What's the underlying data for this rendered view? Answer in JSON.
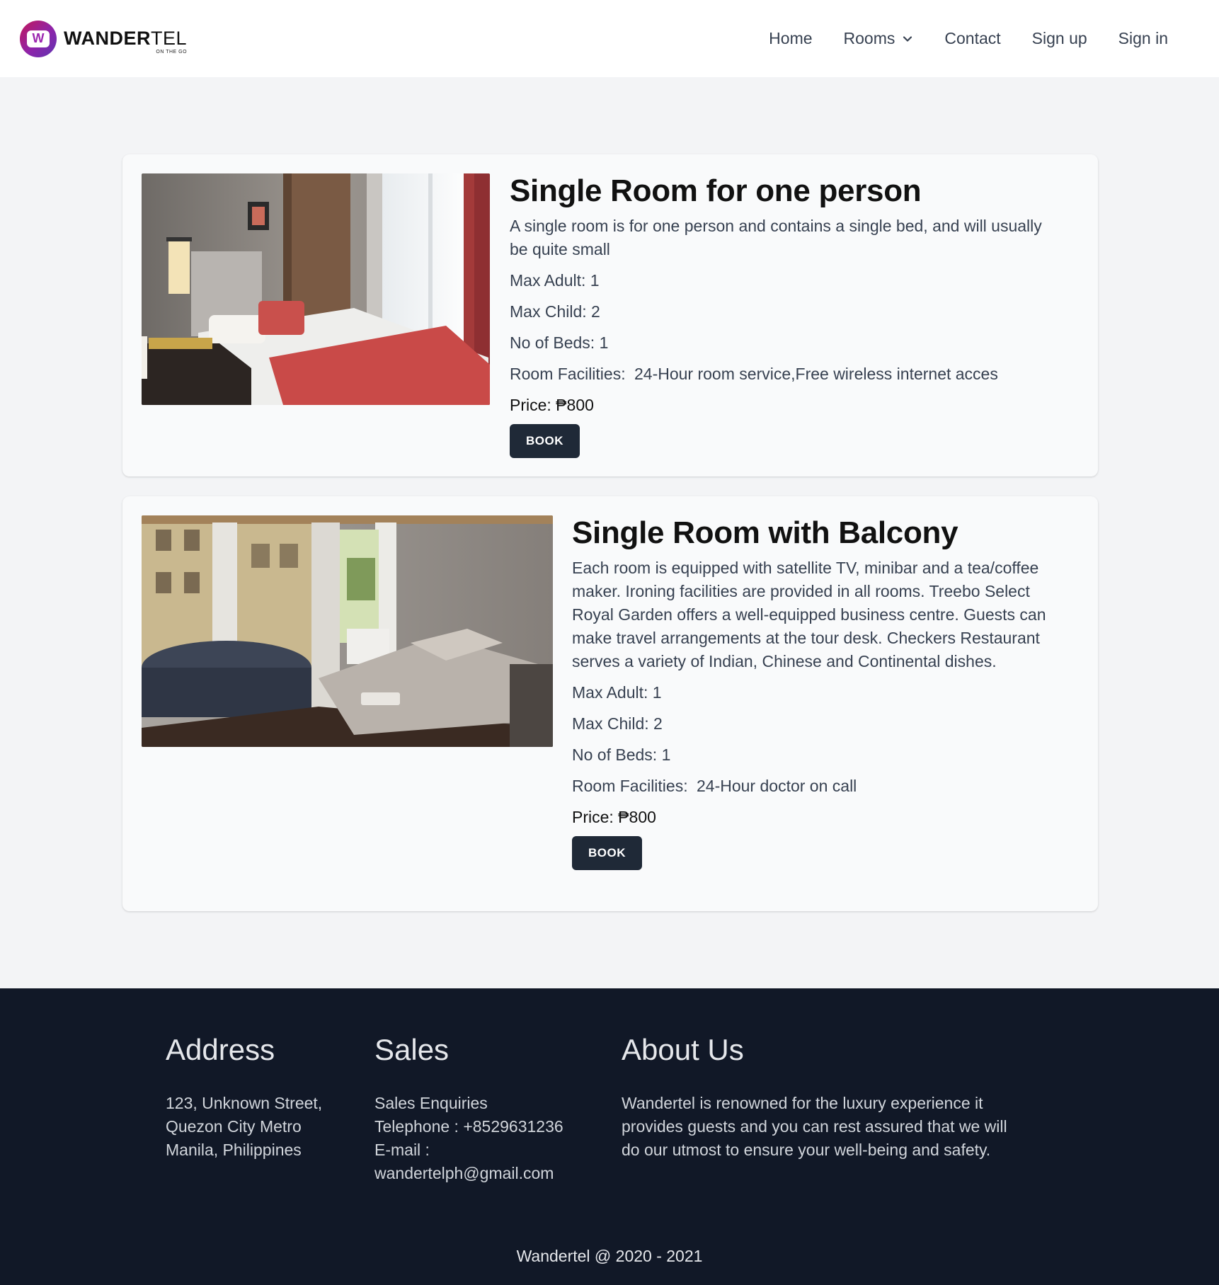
{
  "header": {
    "brand": {
      "name_bold": "WANDER",
      "name_light": "TEL",
      "tagline": "ON THE GO",
      "logo_letter": "W"
    },
    "nav": [
      {
        "label": "Home"
      },
      {
        "label": "Rooms",
        "icon": "chevron-down-icon"
      },
      {
        "label": "Contact"
      },
      {
        "label": "Sign up"
      },
      {
        "label": "Sign in"
      }
    ]
  },
  "rooms": [
    {
      "title": "Single Room for one person",
      "description": "A single room is for one person and contains a single bed, and will usually be quite small",
      "max_adult": "Max Adult: 1",
      "max_child": "Max Child: 2",
      "beds": "No of Beds: 1",
      "facilities_label": "Room Facilities:",
      "facilities_value": "24-Hour room service,Free wireless internet acces",
      "price": "Price: ₱800",
      "book_label": "BOOK"
    },
    {
      "title": "Single Room with Balcony",
      "description": "Each room is equipped with satellite TV, minibar and a tea/coffee maker. Ironing facilities are provided in all rooms. Treebo Select Royal Garden offers a well-equipped business centre. Guests can make travel arrangements at the tour desk. Checkers Restaurant serves a variety of Indian, Chinese and Continental dishes.",
      "max_adult": "Max Adult: 1",
      "max_child": "Max Child: 2",
      "beds": "No of Beds: 1",
      "facilities_label": "Room Facilities:",
      "facilities_value": "24-Hour doctor on call",
      "price": "Price: ₱800",
      "book_label": "BOOK"
    }
  ],
  "footer": {
    "address": {
      "heading": "Address",
      "lines": [
        "123, Unknown Street,",
        "Quezon City Metro",
        "Manila, Philippines"
      ]
    },
    "sales": {
      "heading": "Sales",
      "lines": [
        "Sales Enquiries",
        "Telephone : +8529631236",
        "E-mail :",
        "wandertelph@gmail.com"
      ]
    },
    "about": {
      "heading": "About Us",
      "lines": [
        "Wandertel is renowned for the luxury experience it",
        "provides guests and you can rest assured that we will",
        "do our utmost to ensure your well-being and safety."
      ]
    },
    "copyright": "Wandertel @ 2020 - 2021"
  },
  "colors": {
    "page_bg": "#f3f4f6",
    "header_bg": "#ffffff",
    "card_bg": "#f9fafb",
    "button_bg": "#1f2937",
    "footer_bg": "#111827",
    "brand_gradient": [
      "#c2185b",
      "#8e24aa",
      "#5e35b1"
    ]
  }
}
